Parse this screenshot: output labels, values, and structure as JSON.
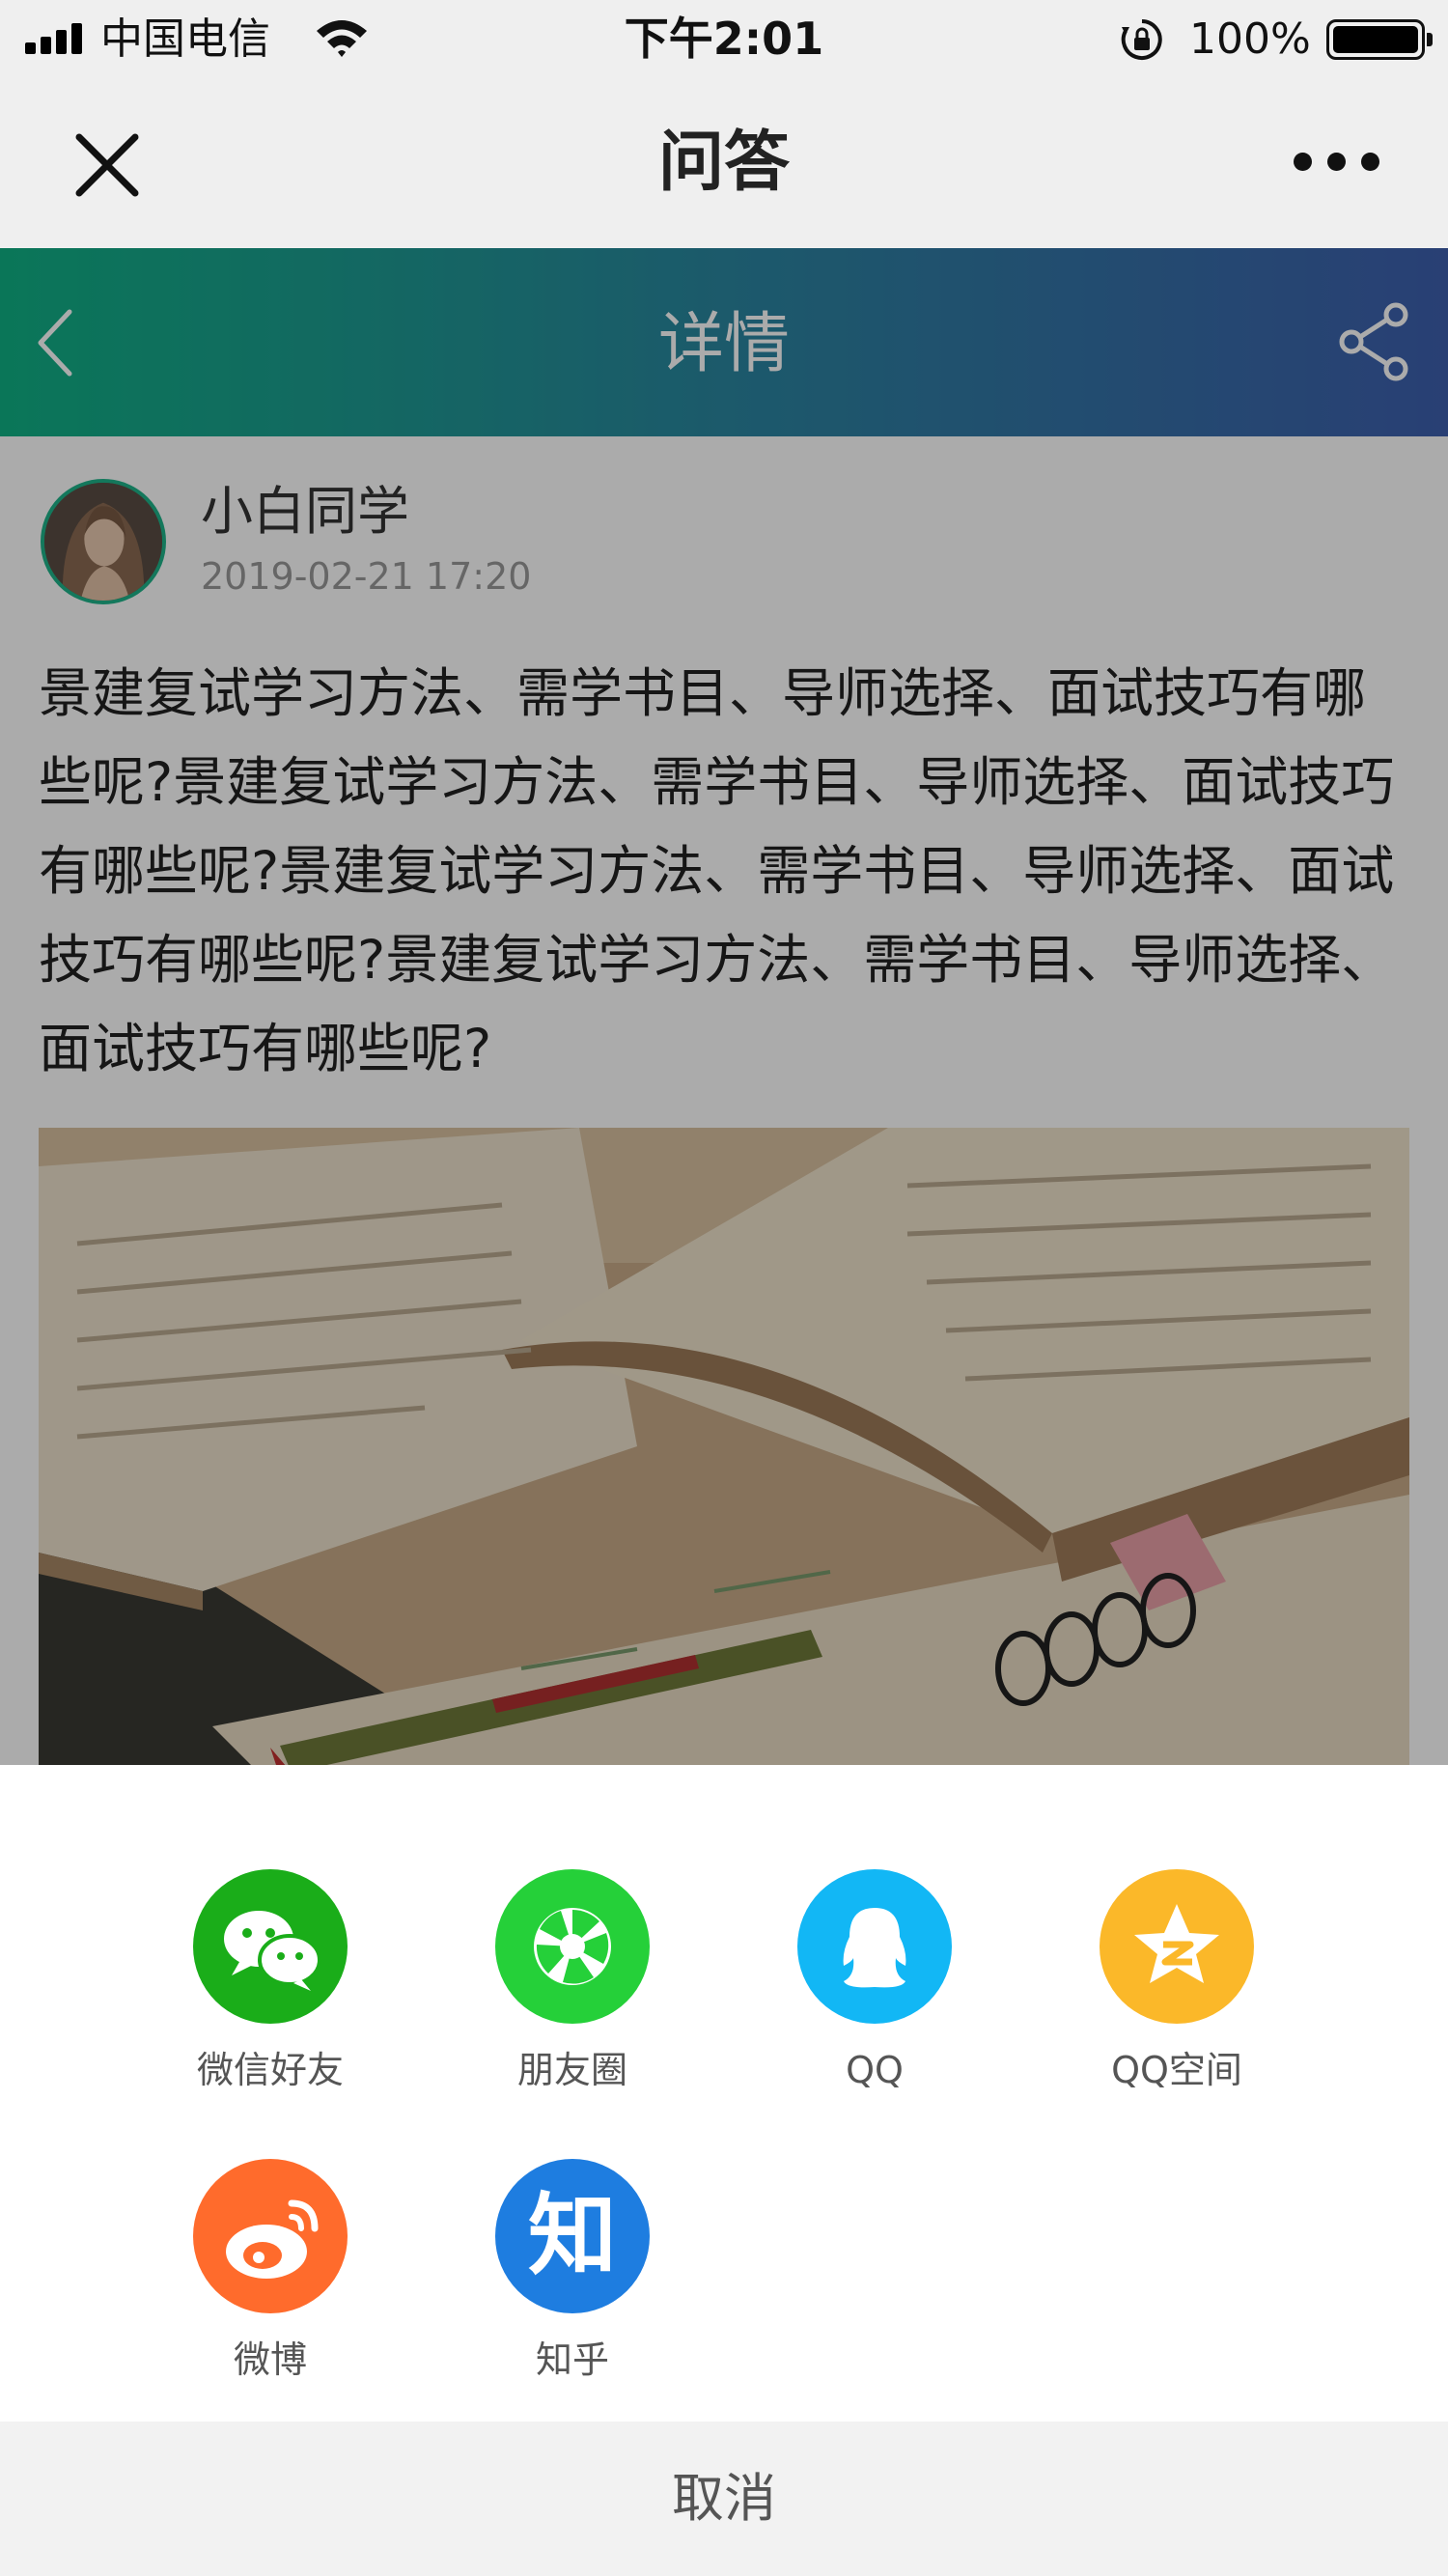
{
  "status_bar": {
    "carrier": "中国电信",
    "time": "下午2:01",
    "battery": "100%"
  },
  "mini_nav": {
    "title": "问答",
    "close_icon": "close-icon",
    "more_icon": "more-icon"
  },
  "header": {
    "title": "详情",
    "back_icon": "chevron-left-icon",
    "share_icon": "share-icon",
    "gradient": [
      "#10b184",
      "#3e5fae"
    ]
  },
  "post": {
    "author": "小白同学",
    "time": "2019-02-21 17:20",
    "question": "景建复试学习方法、需学书目、导师选择、面试技巧有哪些呢?景建复试学习方法、需学书目、导师选择、面试技巧有哪些呢?景建复试学习方法、需学书目、导师选择、面试技巧有哪些呢?景建复试学习方法、需学书目、导师选择、面试技巧有哪些呢?",
    "image": "open-books-photo"
  },
  "share_sheet": {
    "items": [
      {
        "label": "微信好友",
        "icon": "wechat-icon",
        "color": "#1aad19"
      },
      {
        "label": "朋友圈",
        "icon": "moments-icon",
        "color": "#25d039"
      },
      {
        "label": "QQ",
        "icon": "qq-icon",
        "color": "#12b7f5"
      },
      {
        "label": "QQ空间",
        "icon": "qzone-icon",
        "color": "#fbb829"
      },
      {
        "label": "微博",
        "icon": "weibo-icon",
        "color": "#ff6b2c"
      },
      {
        "label": "知乎",
        "icon": "zhihu-icon",
        "color": "#1e7de0"
      }
    ],
    "cancel": "取消",
    "zhihu_glyph": "知"
  }
}
